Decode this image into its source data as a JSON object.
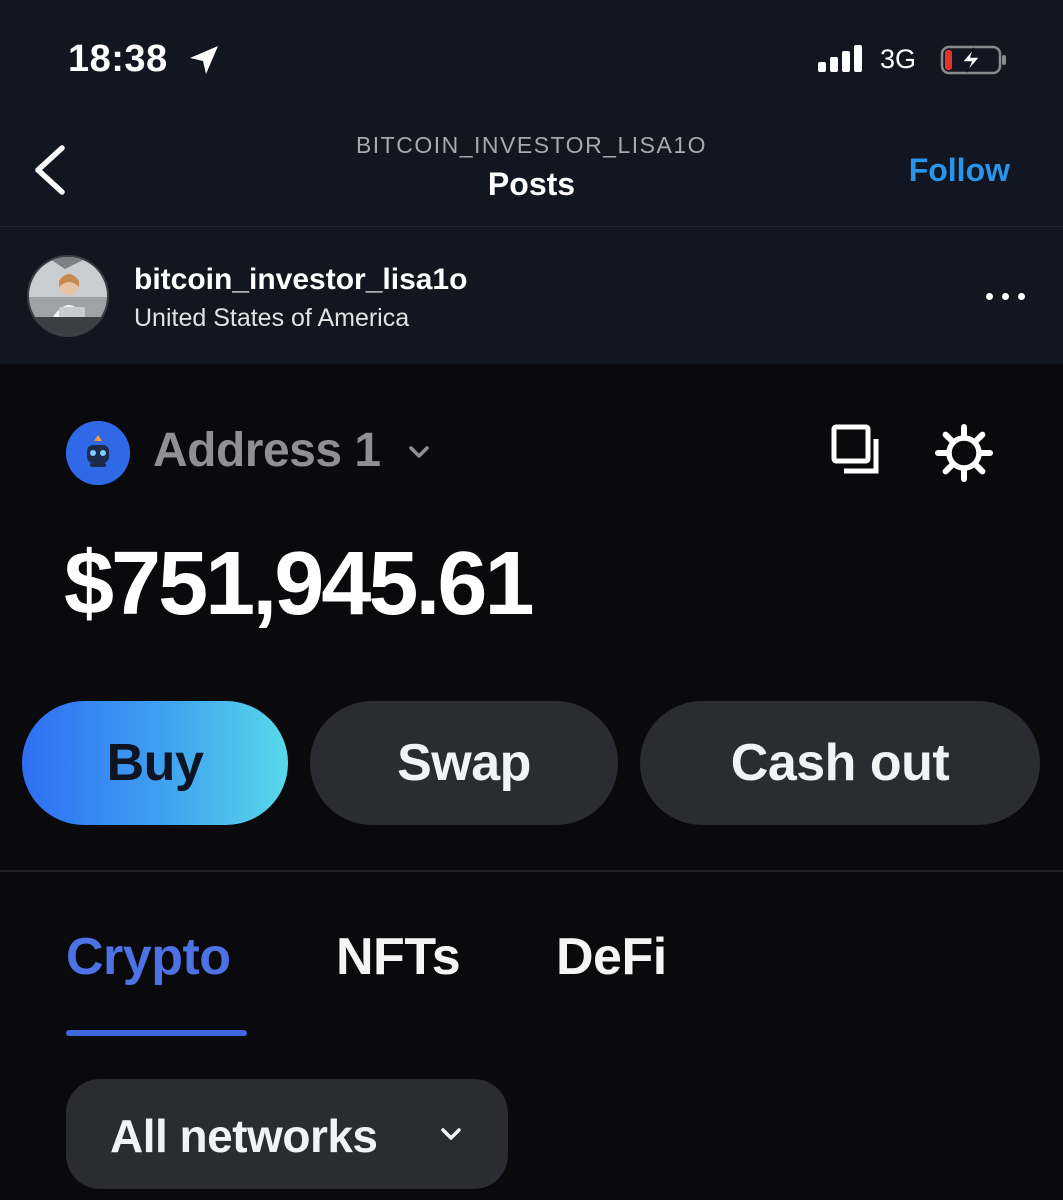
{
  "status_bar": {
    "time": "18:38",
    "network": "3G",
    "icons": [
      "location-arrow-icon",
      "signal-bars-icon",
      "battery-charging-icon"
    ],
    "battery_color": "#e5322d"
  },
  "nav": {
    "account": "BITCOIN_INVESTOR_LISA1O",
    "title": "Posts",
    "follow_label": "Follow",
    "follow_color": "#2a93ea"
  },
  "profile": {
    "username": "bitcoin_investor_lisa1o",
    "location": "United States of America"
  },
  "wallet": {
    "address_label": "Address 1",
    "balance": "$751,945.61",
    "accent": "#2f69e8",
    "actions": [
      {
        "label": "Buy"
      },
      {
        "label": "Swap"
      },
      {
        "label": "Cash out"
      }
    ],
    "tabs": [
      {
        "label": "Crypto",
        "active": true
      },
      {
        "label": "NFTs",
        "active": false
      },
      {
        "label": "DeFi",
        "active": false
      }
    ],
    "active_tab_color": "#4d72e6",
    "network_filter": "All networks"
  }
}
